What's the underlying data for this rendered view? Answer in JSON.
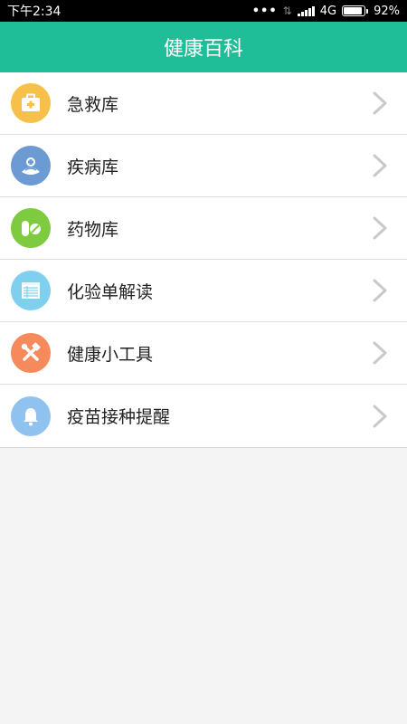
{
  "status_bar": {
    "time": "下午2:34",
    "network": "4G",
    "battery": "92%",
    "battery_level": 0.92
  },
  "header": {
    "title": "健康百科"
  },
  "items": [
    {
      "label": "急救库",
      "icon": "first-aid-kit-icon",
      "color": "#f7c04b"
    },
    {
      "label": "疾病库",
      "icon": "disease-icon",
      "color": "#6b9bd2"
    },
    {
      "label": "药物库",
      "icon": "pill-icon",
      "color": "#7ecb3f"
    },
    {
      "label": "化验单解读",
      "icon": "lab-report-icon",
      "color": "#7fd0ee"
    },
    {
      "label": "健康小工具",
      "icon": "tools-icon",
      "color": "#f68a5a"
    },
    {
      "label": "疫苗接种提醒",
      "icon": "bell-icon",
      "color": "#8fc2ef"
    }
  ],
  "colors": {
    "header": "#1fbd98",
    "background": "#f4f4f4"
  }
}
